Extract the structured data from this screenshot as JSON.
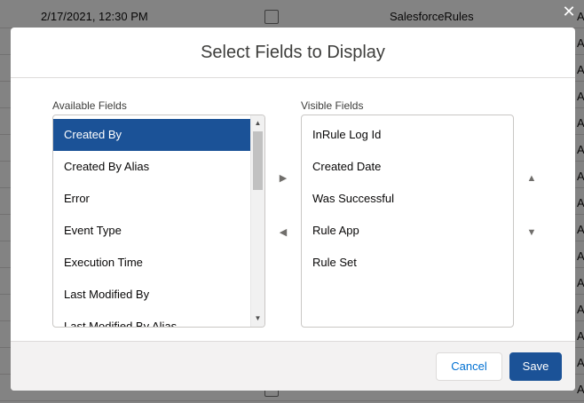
{
  "background_table": {
    "rows": [
      {
        "date": "2/17/2021, 12:30 PM",
        "source": "SalesforceRules",
        "trail": "A"
      },
      {
        "date": "",
        "source": "",
        "trail": "A"
      },
      {
        "date": "",
        "source": "",
        "trail": "A"
      },
      {
        "date": "",
        "source": "",
        "trail": "A"
      },
      {
        "date": "",
        "source": "",
        "trail": "A"
      },
      {
        "date": "",
        "source": "",
        "trail": "A"
      },
      {
        "date": "",
        "source": "",
        "trail": "A"
      },
      {
        "date": "",
        "source": "",
        "trail": "A"
      },
      {
        "date": "",
        "source": "",
        "trail": "A"
      },
      {
        "date": "",
        "source": "",
        "trail": "A"
      },
      {
        "date": "",
        "source": "",
        "trail": "A"
      },
      {
        "date": "",
        "source": "",
        "trail": "A"
      },
      {
        "date": "",
        "source": "",
        "trail": "A"
      },
      {
        "date": "",
        "source": "",
        "trail": "A"
      },
      {
        "date": "",
        "source": "",
        "trail": "A"
      }
    ]
  },
  "modal": {
    "close_glyph": "✕",
    "title": "Select Fields to Display",
    "available": {
      "label": "Available Fields",
      "items": [
        "Created By",
        "Created By Alias",
        "Error",
        "Event Type",
        "Execution Time",
        "Last Modified By",
        "Last Modified By Alias"
      ],
      "selected": "Created By"
    },
    "visible": {
      "label": "Visible Fields",
      "items": [
        "InRule Log Id",
        "Created Date",
        "Was Successful",
        "Rule App",
        "Rule Set"
      ]
    },
    "move_right_glyph": "▶",
    "move_left_glyph": "◀",
    "move_up_glyph": "▲",
    "move_down_glyph": "▼",
    "scroll_up_glyph": "▲",
    "scroll_down_glyph": "▼",
    "cancel_label": "Cancel",
    "save_label": "Save"
  },
  "colors": {
    "brand": "#1b5297",
    "link": "#0070d2",
    "overlay": "#080707"
  }
}
